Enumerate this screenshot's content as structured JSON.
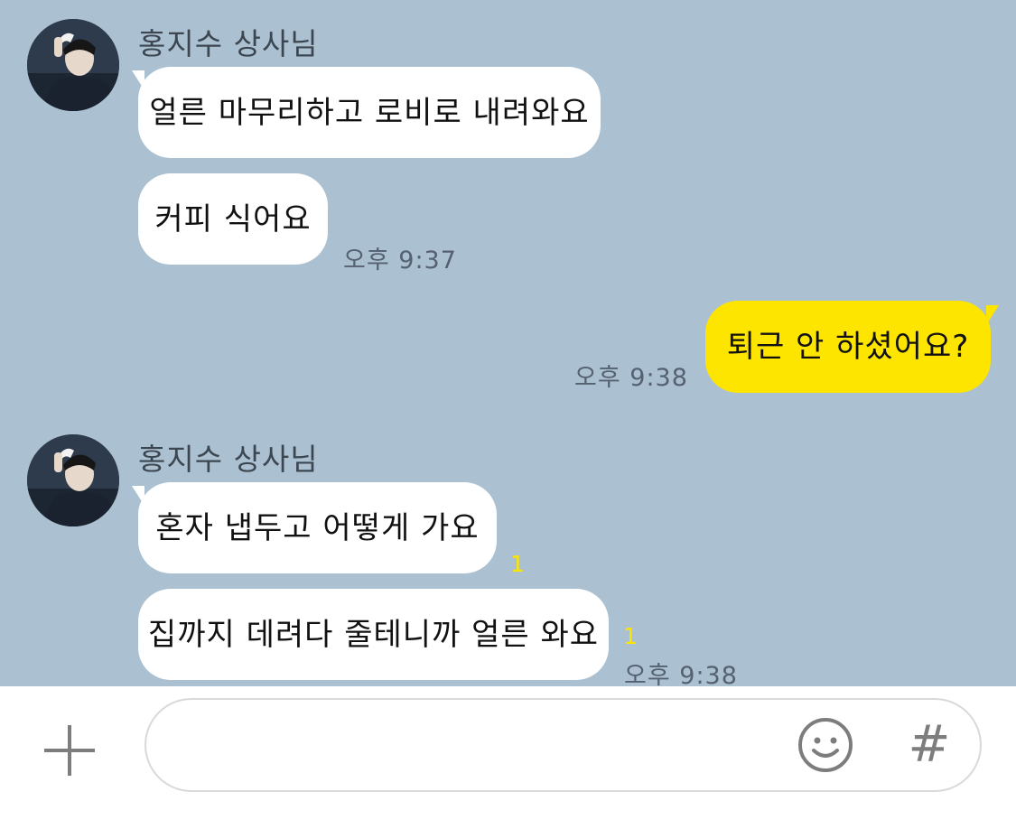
{
  "colors": {
    "chat_background": "#abc1d1",
    "incoming_bubble": "#ffffff",
    "outgoing_bubble": "#fee500",
    "unread_count": "#fee500"
  },
  "messages": {
    "group1": {
      "sender": "홍지수 상사님",
      "bubble1": "얼른 마무리하고 로비로 내려와요",
      "bubble2": "커피 식어요",
      "time": "오후 9:37"
    },
    "mine": {
      "bubble": "퇴근 안 하셨어요?",
      "time": "오후 9:38"
    },
    "group2": {
      "sender": "홍지수 상사님",
      "bubble1": "혼자 냅두고 어떻게 가요",
      "bubble1_unread": "1",
      "bubble2": "집까지 데려다 줄테니까 얼른 와요",
      "bubble2_unread": "1",
      "time": "오후 9:38"
    }
  },
  "composer": {
    "input_value": "",
    "plus_icon": "plus-icon",
    "emoji_icon": "smiley-icon",
    "hash_label": "#"
  }
}
